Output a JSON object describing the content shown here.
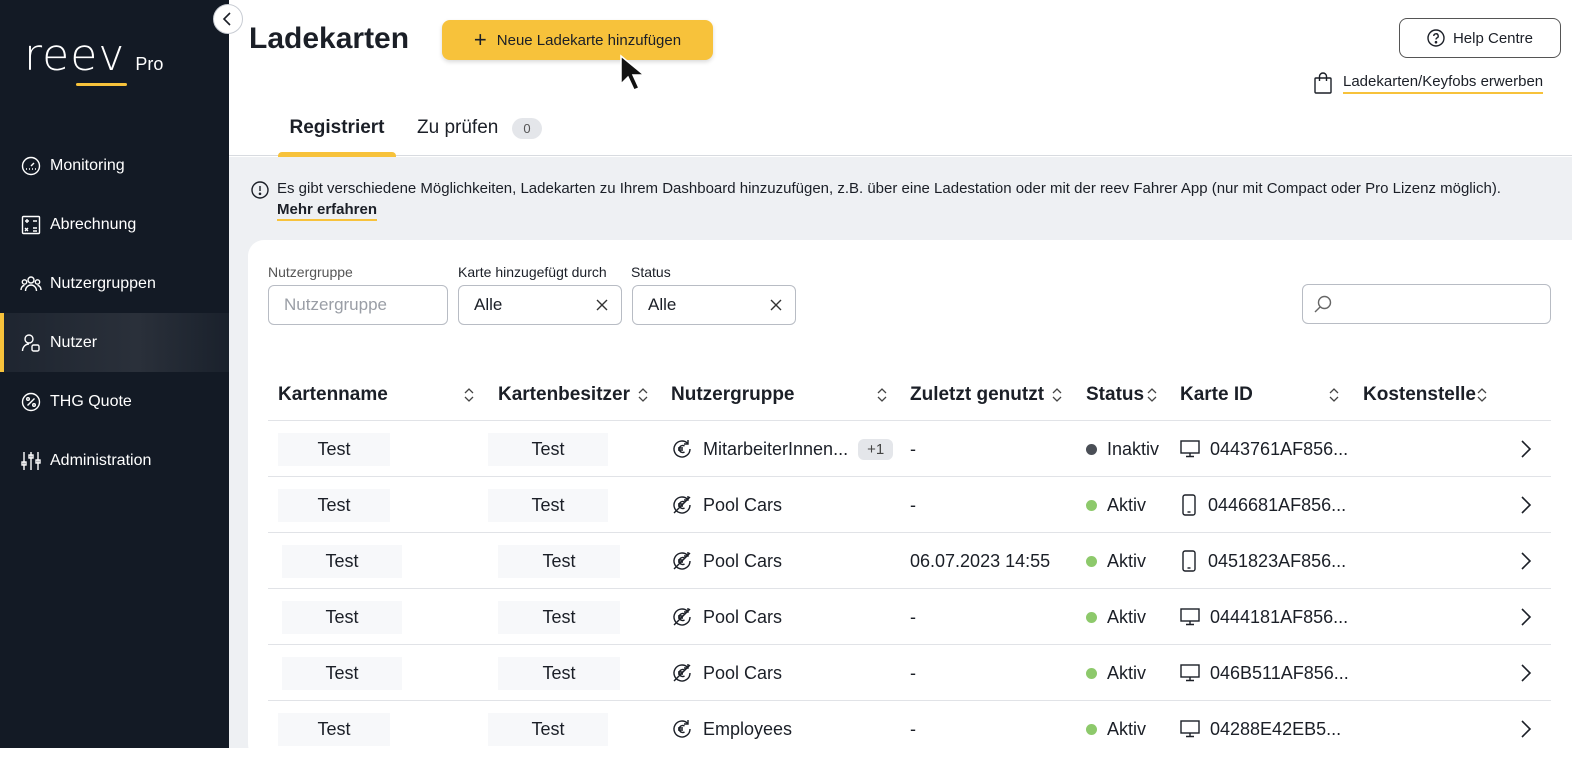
{
  "brand": {
    "name": "reev",
    "edition": "Pro"
  },
  "sidebar": {
    "items": [
      {
        "label": "Monitoring",
        "icon": "gauge-icon"
      },
      {
        "label": "Abrechnung",
        "icon": "calculator-icon"
      },
      {
        "label": "Nutzergruppen",
        "icon": "users-group-icon"
      },
      {
        "label": "Nutzer",
        "icon": "user-icon",
        "active": true
      },
      {
        "label": "THG Quote",
        "icon": "percent-icon"
      },
      {
        "label": "Administration",
        "icon": "sliders-icon"
      }
    ]
  },
  "header": {
    "title": "Ladekarten",
    "add_button": "Neue Ladekarte hinzufügen",
    "help_button": "Help Centre",
    "buy_link": "Ladekarten/Keyfobs erwerben"
  },
  "tabs": [
    {
      "label": "Registriert",
      "active": true
    },
    {
      "label": "Zu prüfen",
      "count": "0"
    }
  ],
  "info": {
    "text": "Es gibt verschiedene Möglichkeiten, Ladekarten zu Ihrem Dashboard hinzuzufügen, z.B. über eine Ladestation oder mit der reev Fahrer App (nur mit Compact oder Pro Lizenz möglich).",
    "link": "Mehr erfahren"
  },
  "filters": {
    "usergroup": {
      "label": "Nutzergruppe",
      "placeholder": "Nutzergruppe"
    },
    "added_by": {
      "label": "Karte hinzugefügt durch",
      "value": "Alle"
    },
    "status": {
      "label": "Status",
      "value": "Alle"
    },
    "search": {
      "placeholder": ""
    }
  },
  "table": {
    "columns": [
      "Kartenname",
      "Kartenbesitzer",
      "Nutzergruppe",
      "Zuletzt genutzt",
      "Status",
      "Karte ID",
      "Kostenstelle"
    ],
    "rows": [
      {
        "name": "Test",
        "owner": "Test",
        "group": "MitarbeiterInnen...",
        "group_icon": "euro-cycle-icon",
        "extra": "+1",
        "last_used": "-",
        "status": "Inaktiv",
        "status_color": "#4a4e56",
        "card_icon": "monitor-icon",
        "card_id": "0443761AF856..."
      },
      {
        "name": "Test",
        "owner": "Test",
        "group": "Pool Cars",
        "group_icon": "no-euro-icon",
        "last_used": "-",
        "status": "Aktiv",
        "status_color": "#8dc96b",
        "card_icon": "phone-icon",
        "card_id": "0446681AF856..."
      },
      {
        "name": "Test",
        "owner": "Test",
        "group": "Pool Cars",
        "group_icon": "no-euro-icon",
        "last_used": "06.07.2023 14:55",
        "status": "Aktiv",
        "status_color": "#8dc96b",
        "card_icon": "phone-icon",
        "card_id": "0451823AF856..."
      },
      {
        "name": "Test",
        "owner": "Test",
        "group": "Pool Cars",
        "group_icon": "no-euro-icon",
        "last_used": "-",
        "status": "Aktiv",
        "status_color": "#8dc96b",
        "card_icon": "monitor-icon",
        "card_id": "0444181AF856..."
      },
      {
        "name": "Test",
        "owner": "Test",
        "group": "Pool Cars",
        "group_icon": "no-euro-icon",
        "last_used": "-",
        "status": "Aktiv",
        "status_color": "#8dc96b",
        "card_icon": "monitor-icon",
        "card_id": "046B511AF856..."
      },
      {
        "name": "Test",
        "owner": "Test",
        "group": "Employees",
        "group_icon": "euro-cycle-icon",
        "last_used": "-",
        "status": "Aktiv",
        "status_color": "#8dc96b",
        "card_icon": "monitor-icon",
        "card_id": "04288E42EB5..."
      }
    ]
  },
  "colors": {
    "accent": "#f7c23b",
    "sidebar": "#131a25",
    "active_status": "#8dc96b",
    "inactive_status": "#4a4e56"
  }
}
